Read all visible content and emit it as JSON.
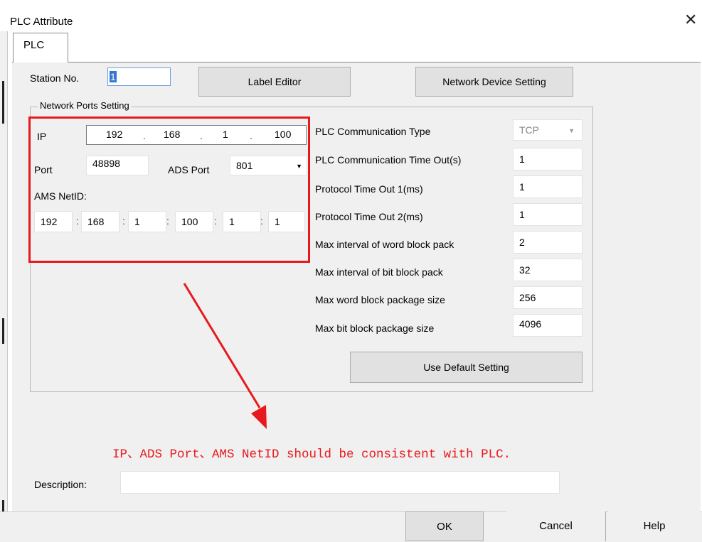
{
  "window": {
    "title": "PLC Attribute",
    "close_glyph": "✕"
  },
  "tabs": [
    {
      "label": "PLC",
      "active": true
    }
  ],
  "station": {
    "label": "Station No.",
    "value": "1"
  },
  "buttons": {
    "label_editor": "Label Editor",
    "network_device_setting": "Network Device Setting",
    "use_default_setting": "Use Default Setting"
  },
  "network_ports": {
    "group_label": "Network Ports Setting",
    "ip_label": "IP",
    "ip": [
      "192",
      "168",
      "1",
      "100"
    ],
    "ip_separator": ".",
    "port_label": "Port",
    "port_value": "48898",
    "ads_port_label": "ADS Port",
    "ads_port_value": "801",
    "ams_netid_label": "AMS NetID:",
    "ams_netid": [
      "192",
      "168",
      "1",
      "100",
      "1",
      "1"
    ],
    "ams_separator": ":"
  },
  "comm": {
    "type_label": "PLC Communication Type",
    "type_value": "TCP",
    "rows": [
      {
        "label": "PLC Communication Time Out(s)",
        "value": "1"
      },
      {
        "label": "Protocol Time Out 1(ms)",
        "value": "1"
      },
      {
        "label": "Protocol Time Out 2(ms)",
        "value": "1"
      },
      {
        "label": "Max interval of word block pack",
        "value": "2"
      },
      {
        "label": "Max interval of bit block pack",
        "value": "32"
      },
      {
        "label": "Max word block package size",
        "value": "256"
      },
      {
        "label": "Max bit block package size",
        "value": "4096"
      }
    ]
  },
  "annotation": {
    "text": "IP、ADS Port、AMS NetID should be consistent with PLC.",
    "color": "#e8191c"
  },
  "description": {
    "label": "Description:",
    "value": ""
  },
  "footer": {
    "ok": "OK",
    "cancel": "Cancel",
    "help": "Help"
  },
  "icons": {
    "dropdown": "▼",
    "close": "close-icon"
  }
}
